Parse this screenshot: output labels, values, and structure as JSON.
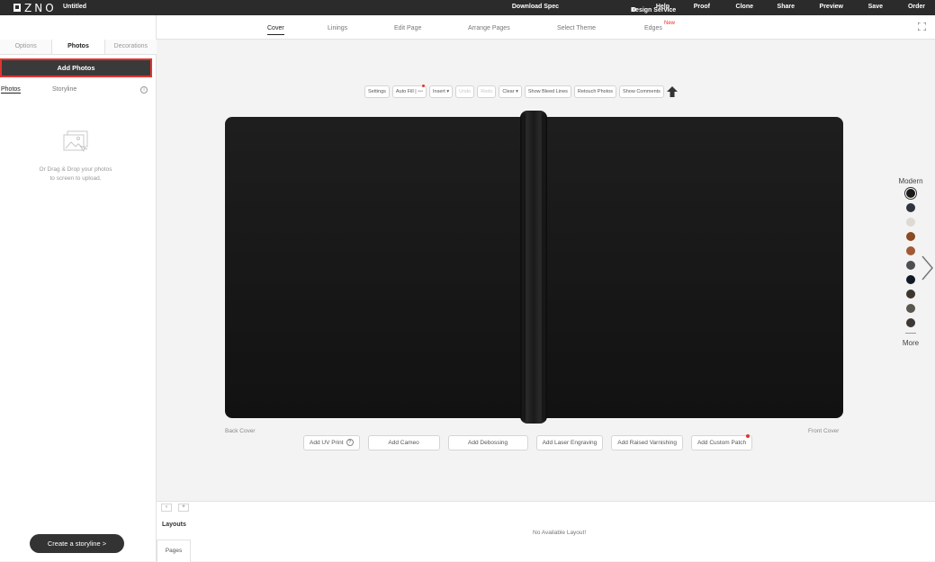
{
  "app": {
    "logo": "ZNO",
    "document_title": "Untitled"
  },
  "topnav": {
    "items": [
      "Download Spec",
      "Design Service",
      "Help",
      "Proof",
      "Clone",
      "Share",
      "Preview",
      "Save",
      "Order"
    ]
  },
  "subtabs": {
    "items": [
      "Cover",
      "Linings",
      "Edit Page",
      "Arrange Pages",
      "Select Theme",
      "Edges"
    ],
    "active": "Cover",
    "new_badge": "New"
  },
  "left_panel": {
    "tabs": [
      "Options",
      "Photos",
      "Decorations"
    ],
    "active_tab": "Photos",
    "add_photos_label": "Add Photos",
    "photo_tabs": [
      "Photos",
      "Storyline"
    ],
    "info_icon": "info-icon",
    "drop_text_line1": "Or Drag & Drop your photos",
    "drop_text_line2": "to screen to upload.",
    "storyline_button": "Create a storyline >"
  },
  "toolbar": {
    "settings": "Settings",
    "auto_fill": "Auto Fill",
    "insert": "Insert",
    "undo": "Undo",
    "redo": "Redo",
    "clear": "Clear",
    "show_bleed_lines": "Show Bleed Lines",
    "retouch_photos": "Retouch Photos",
    "show_comments": "Show Comments"
  },
  "cover": {
    "back_label": "Back Cover",
    "front_label": "Front Cover",
    "material_color": "#141414"
  },
  "cover_options": {
    "add_uv_print": "Add UV Print",
    "add_cameo": "Add Cameo",
    "add_debossing": "Add Debossing",
    "add_laser_engraving": "Add Laser Engraving",
    "add_raised_varnishing": "Add Raised Varnishing",
    "add_custom_patch": "Add Custom Patch"
  },
  "swatches": {
    "title": "Modern",
    "colors": [
      "#1a1a1a",
      "#2f3540",
      "#dcdad2",
      "#8a4a22",
      "#a05a35",
      "#4d4f55",
      "#111a27",
      "#3d3730",
      "#5a5650",
      "#3b3836"
    ],
    "selected_index": 0,
    "more_label": "More"
  },
  "bottom": {
    "layouts_label": "Layouts",
    "pages_tab": "Pages",
    "empty_message": "No Available Layout!"
  },
  "colors": {
    "topbar": "#2b2b2b",
    "accent_red": "#e0352f"
  }
}
